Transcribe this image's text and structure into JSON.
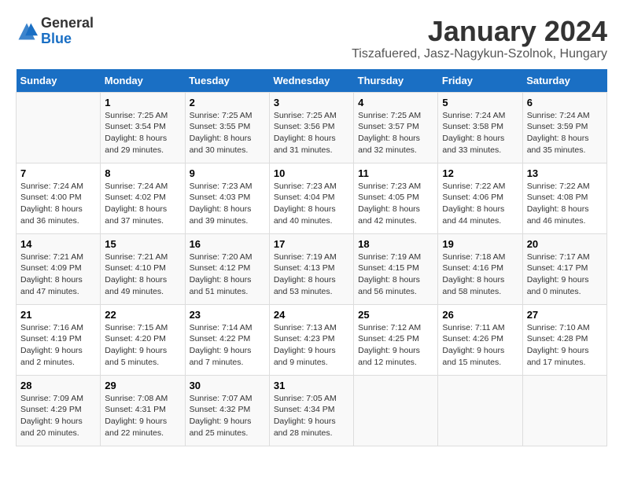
{
  "header": {
    "logo_general": "General",
    "logo_blue": "Blue",
    "month_title": "January 2024",
    "location": "Tiszafuered, Jasz-Nagykun-Szolnok, Hungary"
  },
  "days_of_week": [
    "Sunday",
    "Monday",
    "Tuesday",
    "Wednesday",
    "Thursday",
    "Friday",
    "Saturday"
  ],
  "weeks": [
    [
      {
        "day": "",
        "info": ""
      },
      {
        "day": "1",
        "info": "Sunrise: 7:25 AM\nSunset: 3:54 PM\nDaylight: 8 hours\nand 29 minutes."
      },
      {
        "day": "2",
        "info": "Sunrise: 7:25 AM\nSunset: 3:55 PM\nDaylight: 8 hours\nand 30 minutes."
      },
      {
        "day": "3",
        "info": "Sunrise: 7:25 AM\nSunset: 3:56 PM\nDaylight: 8 hours\nand 31 minutes."
      },
      {
        "day": "4",
        "info": "Sunrise: 7:25 AM\nSunset: 3:57 PM\nDaylight: 8 hours\nand 32 minutes."
      },
      {
        "day": "5",
        "info": "Sunrise: 7:24 AM\nSunset: 3:58 PM\nDaylight: 8 hours\nand 33 minutes."
      },
      {
        "day": "6",
        "info": "Sunrise: 7:24 AM\nSunset: 3:59 PM\nDaylight: 8 hours\nand 35 minutes."
      }
    ],
    [
      {
        "day": "7",
        "info": "Sunrise: 7:24 AM\nSunset: 4:00 PM\nDaylight: 8 hours\nand 36 minutes."
      },
      {
        "day": "8",
        "info": "Sunrise: 7:24 AM\nSunset: 4:02 PM\nDaylight: 8 hours\nand 37 minutes."
      },
      {
        "day": "9",
        "info": "Sunrise: 7:23 AM\nSunset: 4:03 PM\nDaylight: 8 hours\nand 39 minutes."
      },
      {
        "day": "10",
        "info": "Sunrise: 7:23 AM\nSunset: 4:04 PM\nDaylight: 8 hours\nand 40 minutes."
      },
      {
        "day": "11",
        "info": "Sunrise: 7:23 AM\nSunset: 4:05 PM\nDaylight: 8 hours\nand 42 minutes."
      },
      {
        "day": "12",
        "info": "Sunrise: 7:22 AM\nSunset: 4:06 PM\nDaylight: 8 hours\nand 44 minutes."
      },
      {
        "day": "13",
        "info": "Sunrise: 7:22 AM\nSunset: 4:08 PM\nDaylight: 8 hours\nand 46 minutes."
      }
    ],
    [
      {
        "day": "14",
        "info": "Sunrise: 7:21 AM\nSunset: 4:09 PM\nDaylight: 8 hours\nand 47 minutes."
      },
      {
        "day": "15",
        "info": "Sunrise: 7:21 AM\nSunset: 4:10 PM\nDaylight: 8 hours\nand 49 minutes."
      },
      {
        "day": "16",
        "info": "Sunrise: 7:20 AM\nSunset: 4:12 PM\nDaylight: 8 hours\nand 51 minutes."
      },
      {
        "day": "17",
        "info": "Sunrise: 7:19 AM\nSunset: 4:13 PM\nDaylight: 8 hours\nand 53 minutes."
      },
      {
        "day": "18",
        "info": "Sunrise: 7:19 AM\nSunset: 4:15 PM\nDaylight: 8 hours\nand 56 minutes."
      },
      {
        "day": "19",
        "info": "Sunrise: 7:18 AM\nSunset: 4:16 PM\nDaylight: 8 hours\nand 58 minutes."
      },
      {
        "day": "20",
        "info": "Sunrise: 7:17 AM\nSunset: 4:17 PM\nDaylight: 9 hours\nand 0 minutes."
      }
    ],
    [
      {
        "day": "21",
        "info": "Sunrise: 7:16 AM\nSunset: 4:19 PM\nDaylight: 9 hours\nand 2 minutes."
      },
      {
        "day": "22",
        "info": "Sunrise: 7:15 AM\nSunset: 4:20 PM\nDaylight: 9 hours\nand 5 minutes."
      },
      {
        "day": "23",
        "info": "Sunrise: 7:14 AM\nSunset: 4:22 PM\nDaylight: 9 hours\nand 7 minutes."
      },
      {
        "day": "24",
        "info": "Sunrise: 7:13 AM\nSunset: 4:23 PM\nDaylight: 9 hours\nand 9 minutes."
      },
      {
        "day": "25",
        "info": "Sunrise: 7:12 AM\nSunset: 4:25 PM\nDaylight: 9 hours\nand 12 minutes."
      },
      {
        "day": "26",
        "info": "Sunrise: 7:11 AM\nSunset: 4:26 PM\nDaylight: 9 hours\nand 15 minutes."
      },
      {
        "day": "27",
        "info": "Sunrise: 7:10 AM\nSunset: 4:28 PM\nDaylight: 9 hours\nand 17 minutes."
      }
    ],
    [
      {
        "day": "28",
        "info": "Sunrise: 7:09 AM\nSunset: 4:29 PM\nDaylight: 9 hours\nand 20 minutes."
      },
      {
        "day": "29",
        "info": "Sunrise: 7:08 AM\nSunset: 4:31 PM\nDaylight: 9 hours\nand 22 minutes."
      },
      {
        "day": "30",
        "info": "Sunrise: 7:07 AM\nSunset: 4:32 PM\nDaylight: 9 hours\nand 25 minutes."
      },
      {
        "day": "31",
        "info": "Sunrise: 7:05 AM\nSunset: 4:34 PM\nDaylight: 9 hours\nand 28 minutes."
      },
      {
        "day": "",
        "info": ""
      },
      {
        "day": "",
        "info": ""
      },
      {
        "day": "",
        "info": ""
      }
    ]
  ]
}
